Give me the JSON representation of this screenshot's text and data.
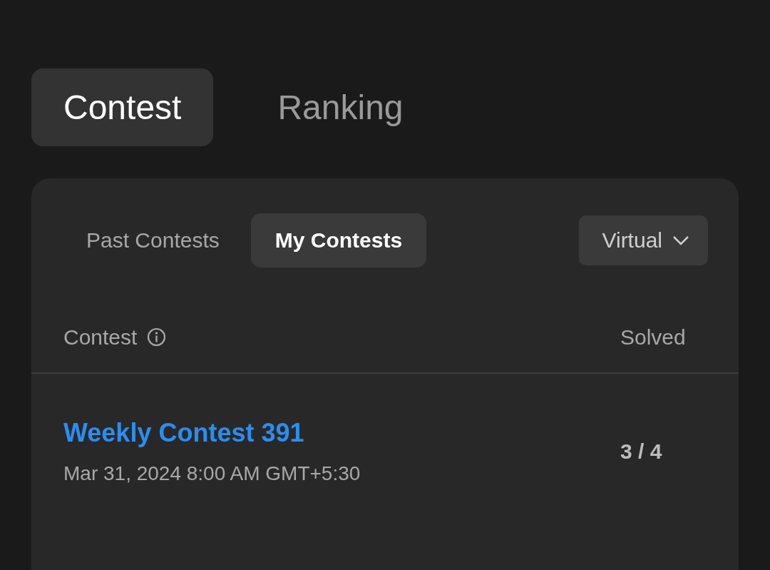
{
  "top_tabs": [
    {
      "label": "Contest",
      "selected": true
    },
    {
      "label": "Ranking",
      "selected": false
    }
  ],
  "card": {
    "tabs": [
      {
        "label": "Past Contests",
        "selected": false
      },
      {
        "label": "My Contests",
        "selected": true
      }
    ],
    "filter": {
      "label": "Virtual"
    },
    "table": {
      "columns": [
        "Contest",
        "Solved"
      ],
      "rows": [
        {
          "title": "Weekly Contest 391",
          "date": "Mar 31, 2024 8:00 AM GMT+5:30",
          "solved": "3 / 4"
        }
      ]
    }
  }
}
